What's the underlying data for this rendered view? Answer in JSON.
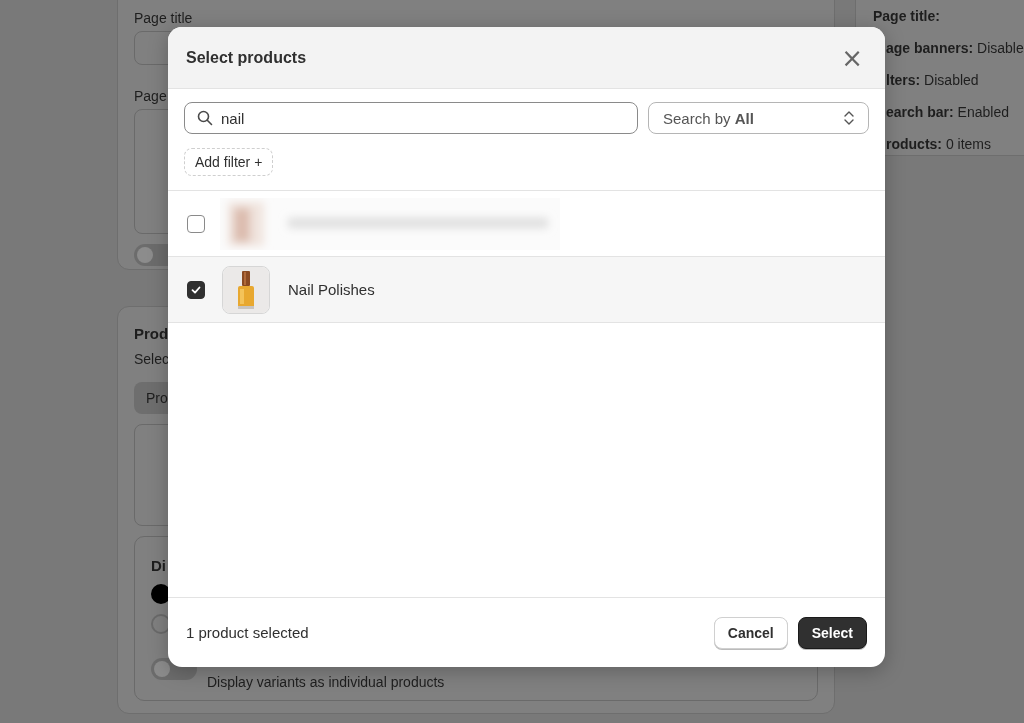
{
  "background": {
    "left_card": {
      "labels": [
        "Page title",
        "Page"
      ],
      "toggle_on": false
    },
    "products_card": {
      "title": "Prod",
      "subtitle": "Selec",
      "tab": "Pro",
      "display_title": "Di",
      "options": [
        {
          "kind": "radio",
          "selected": true
        },
        {
          "kind": "radio",
          "selected": false
        },
        {
          "kind": "toggle",
          "on": false,
          "label": "Display variants as individual products"
        }
      ]
    },
    "summary": [
      {
        "text": "**Page title:**"
      },
      {
        "text": "**age banners:** Disable"
      },
      {
        "text": "**lters:** Disabled"
      },
      {
        "text": "**earch bar:** Enabled"
      },
      {
        "text": "**roducts:** 0 items"
      }
    ]
  },
  "modal": {
    "title": "Select products",
    "close": "×",
    "search": {
      "value": "nail"
    },
    "search_by": "Search by **All**",
    "add_filter": "Add filter +",
    "products": [
      {
        "kind": "blurred",
        "selected": false
      },
      {
        "kind": "product",
        "title": "Nail Polishes",
        "selected": true
      }
    ],
    "footer": {
      "status": "1 product selected",
      "buttons": [
        {
          "label": "Cancel",
          "primary": false
        },
        {
          "label": "Select",
          "primary": true
        }
      ]
    }
  }
}
